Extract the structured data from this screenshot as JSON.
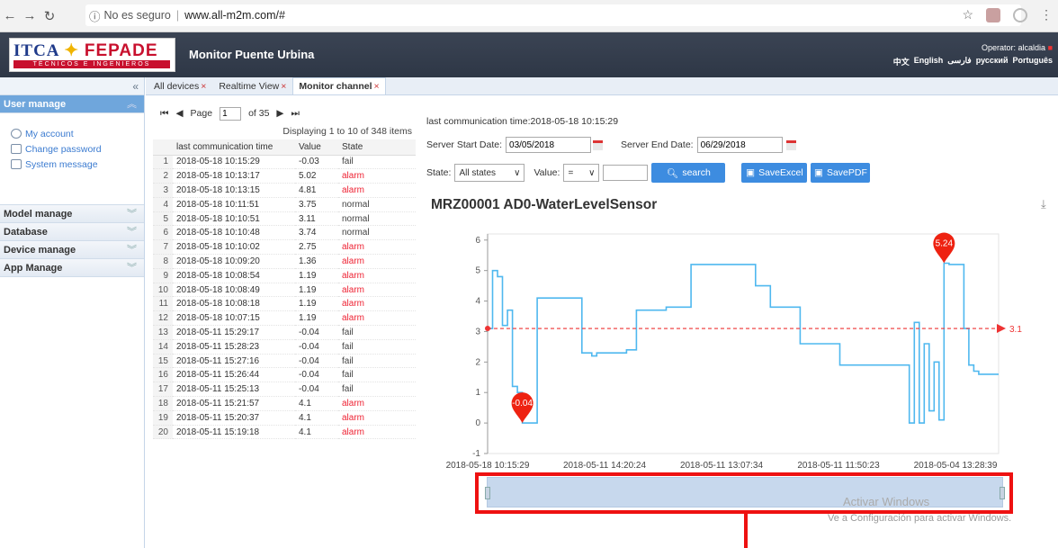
{
  "browser": {
    "back_icon": "arrow-left-icon",
    "forward_icon": "arrow-right-icon",
    "reload_icon": "reload-icon",
    "security": "No es seguro",
    "url": "www.all-m2m.com/#"
  },
  "header": {
    "logo_text_a": "ITCA",
    "logo_text_b": "FEPADE",
    "logo_sub": "TÉCNICOS E INGENIEROS",
    "title": "Monitor Puente Urbina",
    "operator": "Operator: alcaldia",
    "langs": [
      "中文",
      "English",
      "فارسی",
      "русский",
      "Português"
    ]
  },
  "sidebar": {
    "collapse": "«",
    "user_manage": "User manage",
    "menu": [
      {
        "label": "My account",
        "icon": "user-circle-icon"
      },
      {
        "label": "Change password",
        "icon": "lock-icon"
      },
      {
        "label": "System message",
        "icon": "message-icon"
      }
    ],
    "panels": [
      "Model manage",
      "Database",
      "Device manage",
      "App Manage"
    ]
  },
  "tabs": [
    {
      "label": "All devices"
    },
    {
      "label": "Realtime View"
    },
    {
      "label": "Monitor channel"
    }
  ],
  "grid": {
    "page_label": "Page",
    "page": "1",
    "of": "of 35",
    "displaying": "Displaying 1 to 10 of 348 items",
    "headers": [
      "last communication time",
      "Value",
      "State"
    ],
    "rows": [
      [
        "1",
        "2018-05-18 10:15:29",
        "-0.03",
        "fail"
      ],
      [
        "2",
        "2018-05-18 10:13:17",
        "5.02",
        "alarm"
      ],
      [
        "3",
        "2018-05-18 10:13:15",
        "4.81",
        "alarm"
      ],
      [
        "4",
        "2018-05-18 10:11:51",
        "3.75",
        "normal"
      ],
      [
        "5",
        "2018-05-18 10:10:51",
        "3.11",
        "normal"
      ],
      [
        "6",
        "2018-05-18 10:10:48",
        "3.74",
        "normal"
      ],
      [
        "7",
        "2018-05-18 10:10:02",
        "2.75",
        "alarm"
      ],
      [
        "8",
        "2018-05-18 10:09:20",
        "1.36",
        "alarm"
      ],
      [
        "9",
        "2018-05-18 10:08:54",
        "1.19",
        "alarm"
      ],
      [
        "10",
        "2018-05-18 10:08:49",
        "1.19",
        "alarm"
      ],
      [
        "11",
        "2018-05-18 10:08:18",
        "1.19",
        "alarm"
      ],
      [
        "12",
        "2018-05-18 10:07:15",
        "1.19",
        "alarm"
      ],
      [
        "13",
        "2018-05-11 15:29:17",
        "-0.04",
        "fail"
      ],
      [
        "14",
        "2018-05-11 15:28:23",
        "-0.04",
        "fail"
      ],
      [
        "15",
        "2018-05-11 15:27:16",
        "-0.04",
        "fail"
      ],
      [
        "16",
        "2018-05-11 15:26:44",
        "-0.04",
        "fail"
      ],
      [
        "17",
        "2018-05-11 15:25:13",
        "-0.04",
        "fail"
      ],
      [
        "18",
        "2018-05-11 15:21:57",
        "4.1",
        "alarm"
      ],
      [
        "19",
        "2018-05-11 15:20:37",
        "4.1",
        "alarm"
      ],
      [
        "20",
        "2018-05-11 15:19:18",
        "4.1",
        "alarm"
      ]
    ]
  },
  "controls": {
    "last_comm": "last communication time:2018-05-18 10:15:29",
    "start_label": "Server Start Date:",
    "start": "03/05/2018",
    "end_label": "Server End Date:",
    "end": "06/29/2018",
    "state_label": "State:",
    "state_value": "All states",
    "value_label": "Value:",
    "value_op": "=",
    "search": "search",
    "save_excel": "SaveExcel",
    "save_pdf": "SavePDF"
  },
  "chart_data": {
    "type": "line",
    "title": "MRZ00001 AD0-WaterLevelSensor",
    "xticks": [
      "2018-05-18 10:15:29",
      "2018-05-11 14:20:24",
      "2018-05-11 13:07:34",
      "2018-05-11 11:50:23",
      "2018-05-04 13:28:39"
    ],
    "yticks": [
      -1,
      0,
      1,
      2,
      3,
      4,
      5,
      6
    ],
    "ylim": [
      -1,
      6.2
    ],
    "markline": {
      "value": 3.1,
      "label": "3.1"
    },
    "max_label": "5.24",
    "min_label": "-0.04",
    "series": [
      {
        "values": [
          3.1,
          5,
          4.8,
          3.2,
          3.7,
          1.2,
          1,
          0,
          0,
          0,
          4.1,
          4.1,
          4.1,
          4.1,
          4.1,
          4.1,
          4.1,
          4.1,
          4.1,
          2.3,
          2.3,
          2.2,
          2.3,
          2.3,
          2.3,
          2.3,
          2.3,
          2.3,
          2.4,
          2.4,
          3.7,
          3.7,
          3.7,
          3.7,
          3.7,
          3.7,
          3.8,
          3.8,
          3.8,
          3.8,
          3.8,
          5.2,
          5.2,
          5.2,
          5.2,
          5.2,
          5.2,
          5.2,
          5.2,
          5.2,
          5.2,
          5.2,
          5.2,
          5.2,
          4.5,
          4.5,
          4.5,
          3.8,
          3.8,
          3.8,
          3.8,
          3.8,
          3.8,
          2.6,
          2.6,
          2.6,
          2.6,
          2.6,
          2.6,
          2.6,
          2.6,
          1.9,
          1.9,
          1.9,
          1.9,
          1.9,
          1.9,
          1.9,
          1.9,
          1.9,
          1.9,
          1.9,
          1.9,
          1.9,
          1.9,
          0,
          3.3,
          0,
          2.6,
          0.4,
          2,
          0.1,
          5.24,
          5.2,
          5.2,
          5.2,
          3.1,
          1.9,
          1.7,
          1.6,
          1.6,
          1.6,
          1.6,
          1.6
        ]
      }
    ]
  },
  "overlay": {
    "watermark": "Activar Windows",
    "watermark_sub": "Ve a Configuración para activar Windows."
  },
  "colors": {
    "accent": "#3d8ce0",
    "line": "#4fb8ef",
    "alarm": "#e23",
    "annotation": "#ee1111"
  }
}
